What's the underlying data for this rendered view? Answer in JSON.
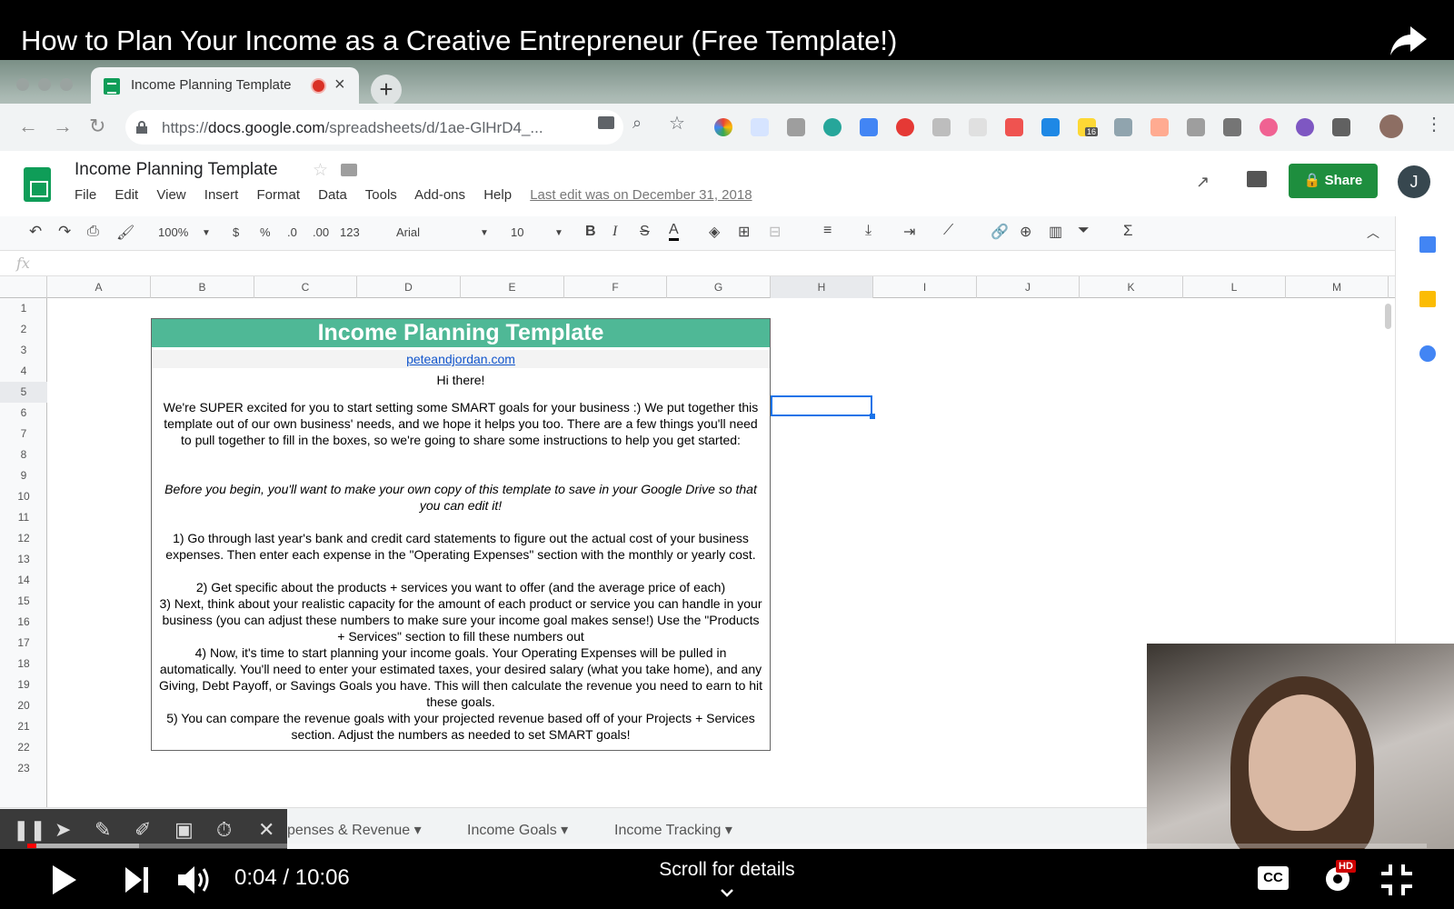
{
  "video": {
    "title": "How to Plan Your Income as a Creative Entrepreneur (Free Template!)",
    "time": "0:04 / 10:06",
    "progress_fraction": 0.0066,
    "loaded_fraction": 0.08,
    "scroll_hint": "Scroll for details",
    "cc_label": "CC",
    "hd_label": "HD"
  },
  "browser": {
    "tab_title": "Income Planning Template",
    "url_prefix": "https://",
    "url_host": "docs.google.com",
    "url_path": "/spreadsheets/d/1ae-GlHrD4_...",
    "extension_badge": "16"
  },
  "sheets": {
    "doc_title": "Income Planning Template",
    "menu": [
      "File",
      "Edit",
      "View",
      "Insert",
      "Format",
      "Data",
      "Tools",
      "Add-ons",
      "Help"
    ],
    "last_edit": "Last edit was on December 31, 2018",
    "share_label": "Share",
    "avatar_letter": "J",
    "toolbar": {
      "zoom": "100%",
      "currency": "$",
      "percent": "%",
      "dec_decrease": ".0",
      "dec_increase": ".00",
      "number_format": "123",
      "font": "Arial",
      "font_size": "10",
      "bold": "B",
      "italic": "I",
      "strike": "S",
      "text_color": "A",
      "sum": "Σ"
    },
    "columns": [
      "A",
      "B",
      "C",
      "D",
      "E",
      "F",
      "G",
      "H",
      "I",
      "J",
      "K",
      "L",
      "M"
    ],
    "rows": [
      "1",
      "2",
      "3",
      "4",
      "5",
      "6",
      "7",
      "8",
      "9",
      "10",
      "11",
      "12",
      "13",
      "14",
      "15",
      "16",
      "17",
      "18",
      "19",
      "20",
      "21",
      "22",
      "23"
    ],
    "selected_column": "H",
    "sheet_tabs": [
      "penses & Revenue",
      "Income Goals",
      "Income Tracking"
    ]
  },
  "template": {
    "header": "Income Planning Template",
    "link": "peteandjordan.com",
    "greeting": "Hi there!",
    "intro": "We're SUPER excited for you to start setting some SMART goals for your business :)  We put together this template out of our own business' needs, and we hope it helps you too. There are a few things you'll need to pull together to fill in the boxes, so we're going to share some instructions to help you get started:",
    "note": "Before you begin, you'll want to make your own copy of this template to save in your Google Drive so that you can edit it!",
    "step1": "1) Go through last year's bank and credit card statements to figure out the actual cost of your business expenses. Then enter each expense in the \"Operating Expenses\" section with the monthly or yearly cost.",
    "step2": "2) Get specific about the products + services you want to offer (and the average price of each)",
    "step3": "3) Next, think about your realistic capacity for the amount of each product or service you can handle in your business (you can adjust these numbers to make sure your income goal makes sense!) Use the \"Products + Services\" section to fill these numbers out",
    "step4": "4) Now, it's time to start planning your income goals. Your Operating Expenses will be pulled in automatically. You'll need to enter your estimated taxes, your desired salary (what you take home), and any Giving, Debt Payoff, or Savings Goals you have. This will then calculate the revenue you need to earn to hit these goals.",
    "step5": "5) You can compare the revenue goals with your projected revenue based off of your Projects + Services section. Adjust the numbers as needed to set SMART goals!"
  },
  "colors": {
    "sheets_green": "#0f9d58",
    "template_header": "#4fb896",
    "share_button": "#1e8e3e",
    "progress": "#ff0000"
  }
}
